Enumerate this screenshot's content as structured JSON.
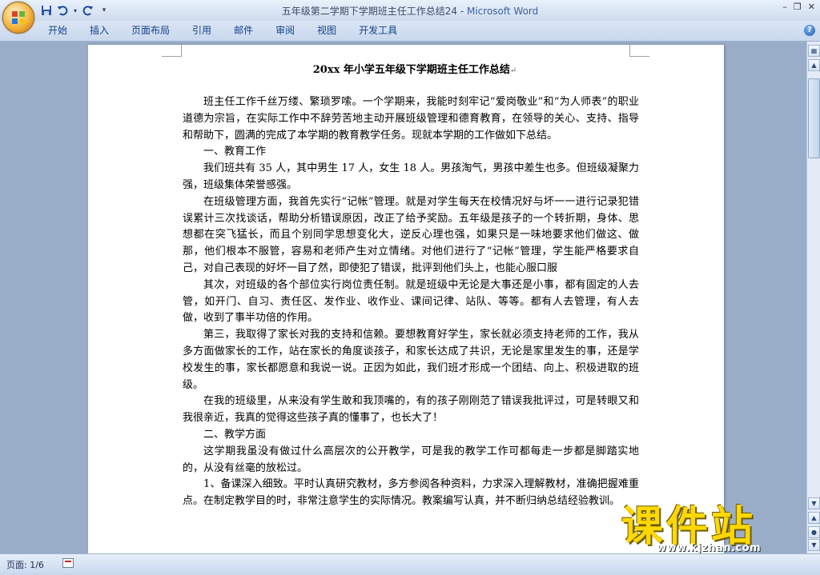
{
  "window": {
    "title": "五年级第二学期下学期班主任工作总结24",
    "separator": " - ",
    "app_name": "Microsoft Word",
    "controls": [
      "–",
      "❐",
      "✕"
    ]
  },
  "quick_access": {
    "more": "▾"
  },
  "ribbon": {
    "tabs": [
      "开始",
      "插入",
      "页面布局",
      "引用",
      "邮件",
      "审阅",
      "视图",
      "开发工具"
    ],
    "help": "?"
  },
  "document": {
    "title": "20xx 年小学五年级下学期班主任工作总结",
    "paragraphs": [
      "班主任工作千丝万缕、繁琐罗嗦。一个学期来，我能时刻牢记“爱岗敬业”和“为人师表”的职业道德为宗旨，在实际工作中不辞劳苦地主动开展班级管理和德育教育，在领导的关心、支持、指导和帮助下，圆满的完成了本学期的教育教学任务。现就本学期的工作做如下总结。",
      "一、教育工作",
      "我们班共有 35 人，其中男生 17 人，女生 18 人。男孩淘气，男孩中差生也多。但班级凝聚力强，班级集体荣誉感强。",
      "在班级管理方面，我首先实行“记帐”管理。就是对学生每天在校情况好与坏一一进行记录犯错误累计三次找谈话，帮助分析错误原因，改正了给予奖励。五年级是孩子的一个转折期，身体、思想都在突飞猛长，而且个别同学思想变化大，逆反心理也强，如果只是一味地要求他们做这、做那，他们根本不服管，容易和老师产生对立情绪。对他们进行了“记帐”管理，学生能严格要求自己，对自己表现的好坏一目了然，即使犯了错误，批评到他们头上，也能心服口服",
      "其次，对班级的各个部位实行岗位责任制。就是班级中无论是大事还是小事，都有固定的人去管，如开门、自习、责任区、发作业、收作业、课间记律、站队、等等。都有人去管理，有人去做，收到了事半功倍的作用。",
      "第三，我取得了家长对我的支持和信赖。要想教育好学生，家长就必须支持老师的工作，我从多方面做家长的工作，站在家长的角度谈孩子，和家长达成了共识，无论是家里发生的事，还是学校发生的事，家长都愿意和我说一说。正因为如此，我们班才形成一个团结、向上、积极进取的班级。",
      "在我的班级里，从来没有学生敢和我顶嘴的，有的孩子刚刚范了错误我批评过，可是转眼又和我很亲近，我真的觉得这些孩子真的懂事了，也长大了！",
      "二、教学方面",
      "这学期我虽没有做过什么高层次的公开教学，可是我的教学工作可都每走一步都是脚踏实地的，从没有丝毫的放松过。",
      "1、备课深入细致。平时认真研究教材，多方参阅各种资料，力求深入理解教材，准确把握难重点。在制定教学目的时，非常注意学生的实际情况。教案编写认真，并不断归纳总结经验教训。"
    ]
  },
  "watermark": {
    "text": "课件站",
    "url": "www.kjzhan.com"
  },
  "statusbar": {
    "page": "页面: 1/6"
  }
}
